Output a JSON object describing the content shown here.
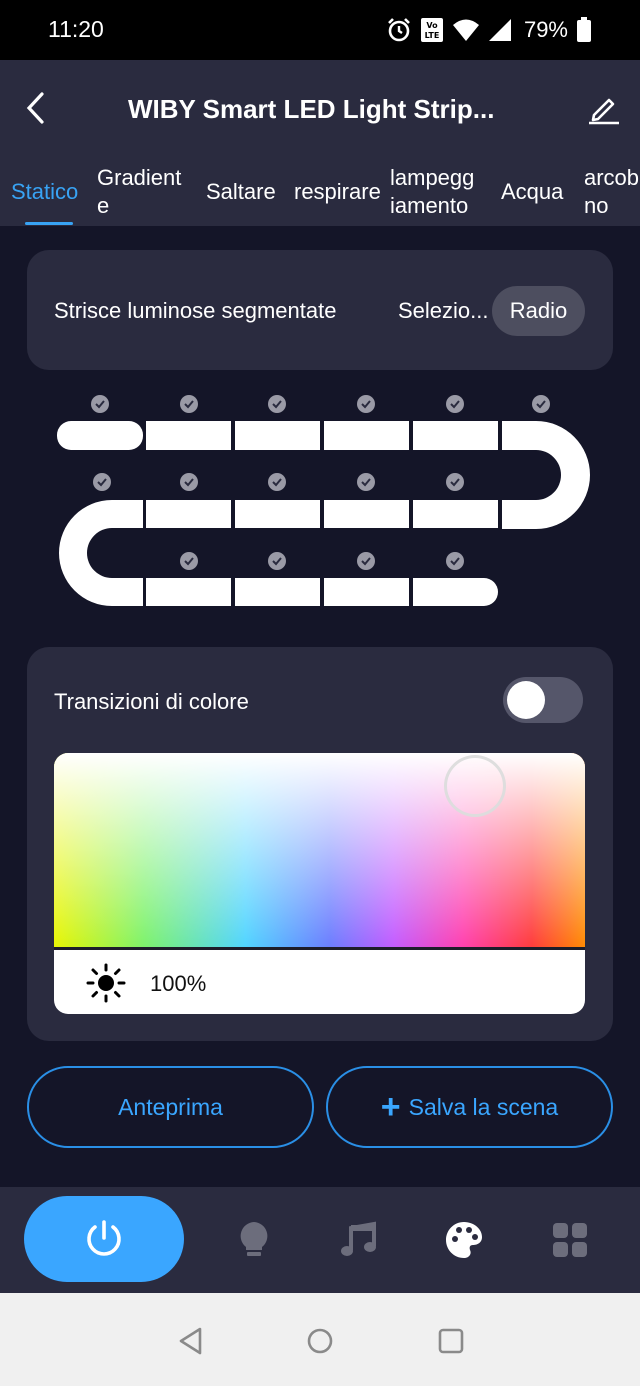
{
  "status_bar": {
    "time": "11:20",
    "battery": "79%"
  },
  "header": {
    "title": "WIBY Smart LED Light Strip..."
  },
  "tabs": [
    {
      "label_line1": "Statico",
      "label_line2": ""
    },
    {
      "label_line1": "Gradient",
      "label_line2": "e"
    },
    {
      "label_line1": "Saltare",
      "label_line2": ""
    },
    {
      "label_line1": "respirare",
      "label_line2": ""
    },
    {
      "label_line1": "lampegg",
      "label_line2": "iamento"
    },
    {
      "label_line1": "Acqua",
      "label_line2": ""
    },
    {
      "label_line1": "arcob",
      "label_line2": "no"
    }
  ],
  "segments": {
    "label": "Strisce luminose segmentate",
    "select_label": "Selezio...",
    "radio_label": "Radio"
  },
  "color": {
    "transitions_label": "Transizioni di colore",
    "transitions_enabled": false,
    "brightness": "100%"
  },
  "actions": {
    "preview_label": "Anteprima",
    "save_label": "Salva la scena",
    "save_icon": "+"
  },
  "bottom_nav": [
    "power-icon",
    "bulb-icon",
    "music-icon",
    "palette-icon",
    "grid-icon"
  ],
  "colors": {
    "accent": "#3aa6ff",
    "background": "#141528",
    "surface": "#2a2b3f"
  }
}
